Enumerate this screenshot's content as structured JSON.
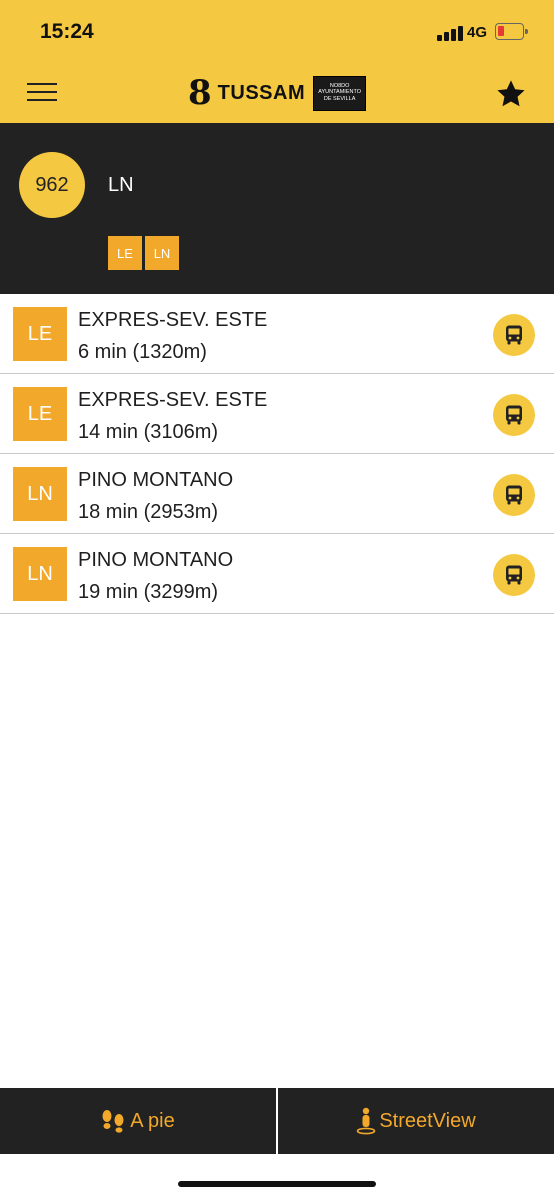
{
  "status_bar": {
    "time": "15:24",
    "network": "4G",
    "signal_icon": "signal-bars-icon",
    "battery_icon": "battery-low-icon",
    "battery_color": "#e53935"
  },
  "header": {
    "menu_icon": "hamburger-menu-icon",
    "logo_text": "TUSSAM",
    "logo_badge_lines": [
      "NO8DO",
      "AYUNTAMIENTO",
      "DE SEVILLA"
    ],
    "favorite_icon": "star-icon"
  },
  "stop": {
    "number": "962",
    "name": "LN",
    "lines": [
      "LE",
      "LN"
    ]
  },
  "arrivals": [
    {
      "line": "LE",
      "destination": "EXPRES-SEV. ESTE",
      "eta": "6 min (1320m)",
      "icon": "bus-icon"
    },
    {
      "line": "LE",
      "destination": "EXPRES-SEV. ESTE",
      "eta": "14 min (3106m)",
      "icon": "bus-icon"
    },
    {
      "line": "LN",
      "destination": "PINO MONTANO",
      "eta": "18 min (2953m)",
      "icon": "bus-icon"
    },
    {
      "line": "LN",
      "destination": "PINO MONTANO",
      "eta": "19 min (3299m)",
      "icon": "bus-icon"
    }
  ],
  "bottom_bar": {
    "walk_label": "A pie",
    "walk_icon": "footprints-icon",
    "streetview_label": "StreetView",
    "streetview_icon": "pegman-icon"
  },
  "colors": {
    "brand_yellow": "#f5c842",
    "accent_orange": "#f2a82b",
    "dark": "#222222"
  }
}
